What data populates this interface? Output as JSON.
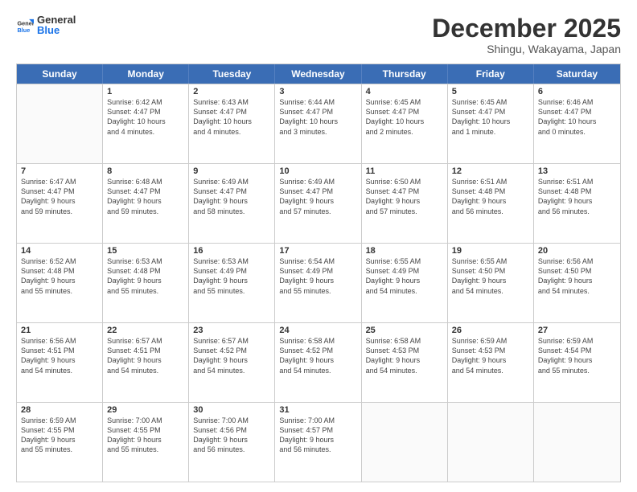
{
  "header": {
    "logo_general": "General",
    "logo_blue": "Blue",
    "month_title": "December 2025",
    "subtitle": "Shingu, Wakayama, Japan"
  },
  "days_of_week": [
    "Sunday",
    "Monday",
    "Tuesday",
    "Wednesday",
    "Thursday",
    "Friday",
    "Saturday"
  ],
  "weeks": [
    [
      {
        "day": "",
        "empty": true
      },
      {
        "day": "1",
        "lines": [
          "Sunrise: 6:42 AM",
          "Sunset: 4:47 PM",
          "Daylight: 10 hours",
          "and 4 minutes."
        ]
      },
      {
        "day": "2",
        "lines": [
          "Sunrise: 6:43 AM",
          "Sunset: 4:47 PM",
          "Daylight: 10 hours",
          "and 4 minutes."
        ]
      },
      {
        "day": "3",
        "lines": [
          "Sunrise: 6:44 AM",
          "Sunset: 4:47 PM",
          "Daylight: 10 hours",
          "and 3 minutes."
        ]
      },
      {
        "day": "4",
        "lines": [
          "Sunrise: 6:45 AM",
          "Sunset: 4:47 PM",
          "Daylight: 10 hours",
          "and 2 minutes."
        ]
      },
      {
        "day": "5",
        "lines": [
          "Sunrise: 6:45 AM",
          "Sunset: 4:47 PM",
          "Daylight: 10 hours",
          "and 1 minute."
        ]
      },
      {
        "day": "6",
        "lines": [
          "Sunrise: 6:46 AM",
          "Sunset: 4:47 PM",
          "Daylight: 10 hours",
          "and 0 minutes."
        ]
      }
    ],
    [
      {
        "day": "7",
        "lines": [
          "Sunrise: 6:47 AM",
          "Sunset: 4:47 PM",
          "Daylight: 9 hours",
          "and 59 minutes."
        ]
      },
      {
        "day": "8",
        "lines": [
          "Sunrise: 6:48 AM",
          "Sunset: 4:47 PM",
          "Daylight: 9 hours",
          "and 59 minutes."
        ]
      },
      {
        "day": "9",
        "lines": [
          "Sunrise: 6:49 AM",
          "Sunset: 4:47 PM",
          "Daylight: 9 hours",
          "and 58 minutes."
        ]
      },
      {
        "day": "10",
        "lines": [
          "Sunrise: 6:49 AM",
          "Sunset: 4:47 PM",
          "Daylight: 9 hours",
          "and 57 minutes."
        ]
      },
      {
        "day": "11",
        "lines": [
          "Sunrise: 6:50 AM",
          "Sunset: 4:47 PM",
          "Daylight: 9 hours",
          "and 57 minutes."
        ]
      },
      {
        "day": "12",
        "lines": [
          "Sunrise: 6:51 AM",
          "Sunset: 4:48 PM",
          "Daylight: 9 hours",
          "and 56 minutes."
        ]
      },
      {
        "day": "13",
        "lines": [
          "Sunrise: 6:51 AM",
          "Sunset: 4:48 PM",
          "Daylight: 9 hours",
          "and 56 minutes."
        ]
      }
    ],
    [
      {
        "day": "14",
        "lines": [
          "Sunrise: 6:52 AM",
          "Sunset: 4:48 PM",
          "Daylight: 9 hours",
          "and 55 minutes."
        ]
      },
      {
        "day": "15",
        "lines": [
          "Sunrise: 6:53 AM",
          "Sunset: 4:48 PM",
          "Daylight: 9 hours",
          "and 55 minutes."
        ]
      },
      {
        "day": "16",
        "lines": [
          "Sunrise: 6:53 AM",
          "Sunset: 4:49 PM",
          "Daylight: 9 hours",
          "and 55 minutes."
        ]
      },
      {
        "day": "17",
        "lines": [
          "Sunrise: 6:54 AM",
          "Sunset: 4:49 PM",
          "Daylight: 9 hours",
          "and 55 minutes."
        ]
      },
      {
        "day": "18",
        "lines": [
          "Sunrise: 6:55 AM",
          "Sunset: 4:49 PM",
          "Daylight: 9 hours",
          "and 54 minutes."
        ]
      },
      {
        "day": "19",
        "lines": [
          "Sunrise: 6:55 AM",
          "Sunset: 4:50 PM",
          "Daylight: 9 hours",
          "and 54 minutes."
        ]
      },
      {
        "day": "20",
        "lines": [
          "Sunrise: 6:56 AM",
          "Sunset: 4:50 PM",
          "Daylight: 9 hours",
          "and 54 minutes."
        ]
      }
    ],
    [
      {
        "day": "21",
        "lines": [
          "Sunrise: 6:56 AM",
          "Sunset: 4:51 PM",
          "Daylight: 9 hours",
          "and 54 minutes."
        ]
      },
      {
        "day": "22",
        "lines": [
          "Sunrise: 6:57 AM",
          "Sunset: 4:51 PM",
          "Daylight: 9 hours",
          "and 54 minutes."
        ]
      },
      {
        "day": "23",
        "lines": [
          "Sunrise: 6:57 AM",
          "Sunset: 4:52 PM",
          "Daylight: 9 hours",
          "and 54 minutes."
        ]
      },
      {
        "day": "24",
        "lines": [
          "Sunrise: 6:58 AM",
          "Sunset: 4:52 PM",
          "Daylight: 9 hours",
          "and 54 minutes."
        ]
      },
      {
        "day": "25",
        "lines": [
          "Sunrise: 6:58 AM",
          "Sunset: 4:53 PM",
          "Daylight: 9 hours",
          "and 54 minutes."
        ]
      },
      {
        "day": "26",
        "lines": [
          "Sunrise: 6:59 AM",
          "Sunset: 4:53 PM",
          "Daylight: 9 hours",
          "and 54 minutes."
        ]
      },
      {
        "day": "27",
        "lines": [
          "Sunrise: 6:59 AM",
          "Sunset: 4:54 PM",
          "Daylight: 9 hours",
          "and 55 minutes."
        ]
      }
    ],
    [
      {
        "day": "28",
        "lines": [
          "Sunrise: 6:59 AM",
          "Sunset: 4:55 PM",
          "Daylight: 9 hours",
          "and 55 minutes."
        ]
      },
      {
        "day": "29",
        "lines": [
          "Sunrise: 7:00 AM",
          "Sunset: 4:55 PM",
          "Daylight: 9 hours",
          "and 55 minutes."
        ]
      },
      {
        "day": "30",
        "lines": [
          "Sunrise: 7:00 AM",
          "Sunset: 4:56 PM",
          "Daylight: 9 hours",
          "and 56 minutes."
        ]
      },
      {
        "day": "31",
        "lines": [
          "Sunrise: 7:00 AM",
          "Sunset: 4:57 PM",
          "Daylight: 9 hours",
          "and 56 minutes."
        ]
      },
      {
        "day": "",
        "empty": true
      },
      {
        "day": "",
        "empty": true
      },
      {
        "day": "",
        "empty": true
      }
    ]
  ]
}
